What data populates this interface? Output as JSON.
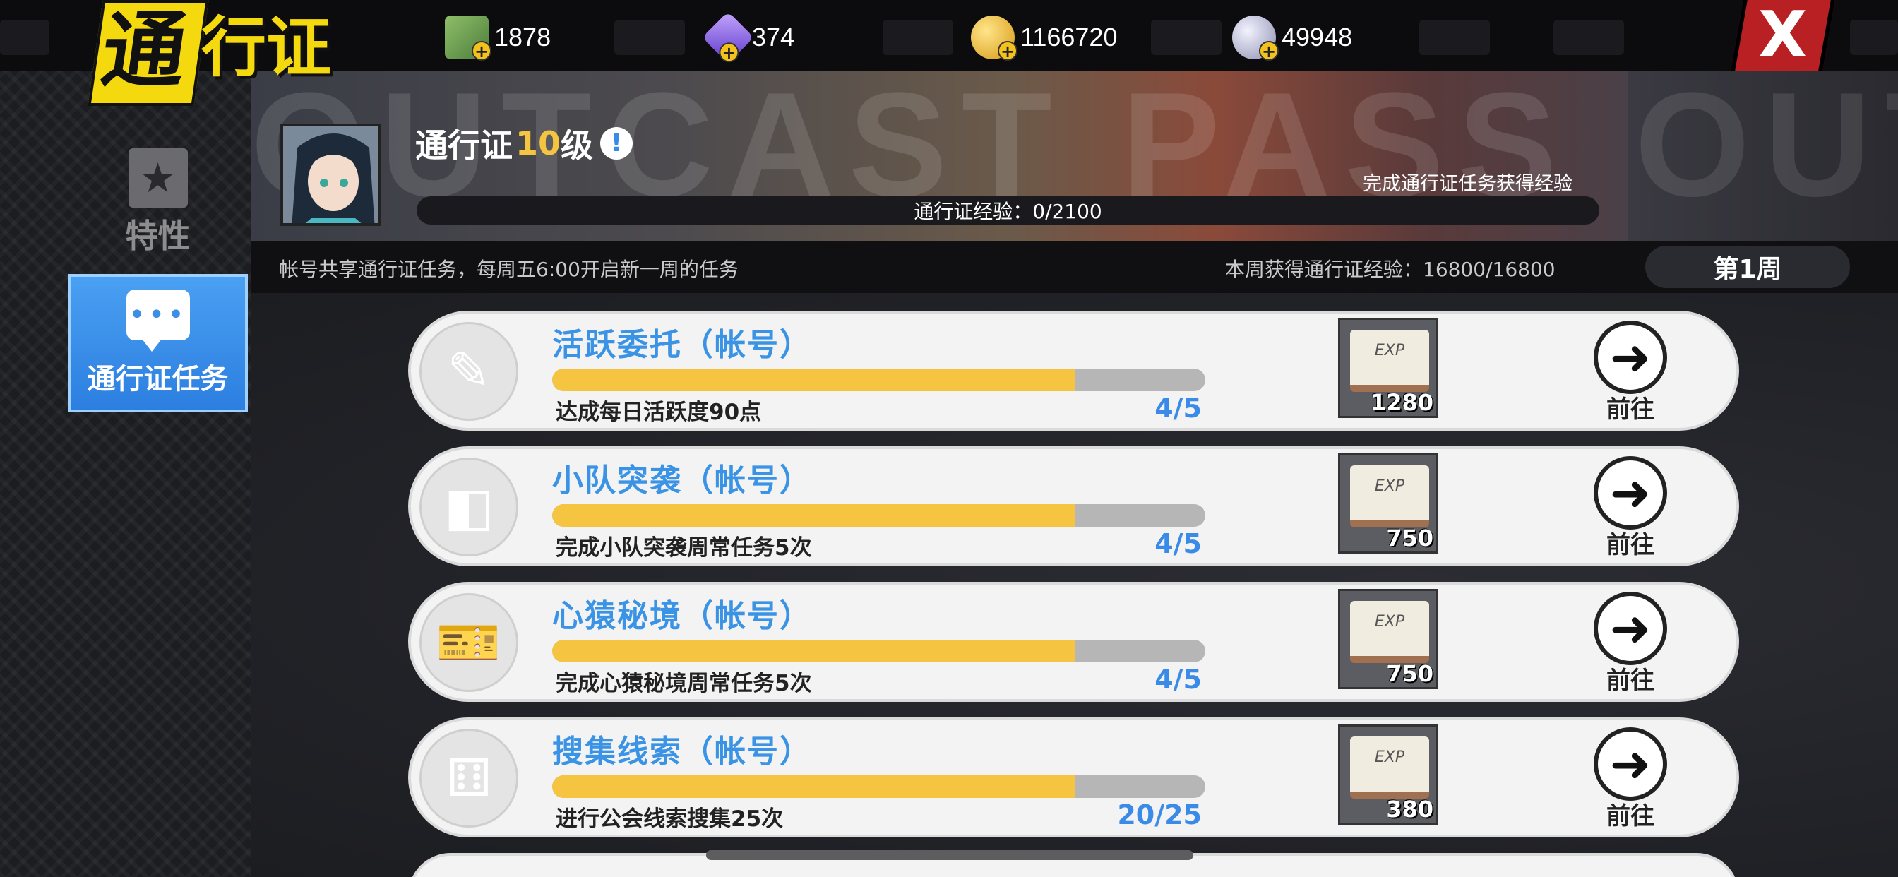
{
  "colors": {
    "accent_blue": "#3a93e4",
    "progress_yellow": "#f5c542",
    "close_red": "#b82024",
    "logo_yellow": "#f5d90f"
  },
  "header": {
    "logo_first_char": "通",
    "logo_rest": "行证",
    "currencies": [
      {
        "icon": "cash-icon",
        "value": "1878"
      },
      {
        "icon": "purple-gem-icon",
        "value": "374"
      },
      {
        "icon": "gold-coin-icon",
        "value": "1166720"
      },
      {
        "icon": "silver-coin-icon",
        "value": "49948"
      }
    ],
    "close_label": "X"
  },
  "sidebar": {
    "items": [
      {
        "label": "特性",
        "icon": "star-icon",
        "active": false
      },
      {
        "label": "通行证任务",
        "icon": "chat-bubble-icon",
        "active": true
      }
    ]
  },
  "banner": {
    "bg_text_left": "OUTCAST PASS",
    "bg_text_right": "OUT",
    "level_prefix": "通行证",
    "level_num": "10",
    "level_suffix": "级",
    "info_icon": "!",
    "exp_hint": "完成通行证任务获得经验",
    "exp_text": "通行证经验：0/2100",
    "exp_current": 0,
    "exp_max": 2100
  },
  "info": {
    "left_text": "帐号共享通行证任务，每周五6:00开启新一周的任务",
    "right_text": "本周获得通行证经验：16800/16800",
    "week_label": "第1周"
  },
  "tasks": [
    {
      "icon": "notebook-pen-icon",
      "icon_glyph": "✎",
      "title": "活跃委托（帐号）",
      "desc": "达成每日活跃度90点",
      "count": "4/5",
      "progress": 0.8,
      "reward": "1280",
      "go_label": "前往"
    },
    {
      "icon": "cube-icon",
      "icon_glyph": "◧",
      "title": "小队突袭（帐号）",
      "desc": "完成小队突袭周常任务5次",
      "count": "4/5",
      "progress": 0.8,
      "reward": "750",
      "go_label": "前往"
    },
    {
      "icon": "ticket-icon",
      "icon_glyph": "🎫",
      "title": "心猿秘境（帐号）",
      "desc": "完成心猿秘境周常任务5次",
      "count": "4/5",
      "progress": 0.8,
      "reward": "750",
      "go_label": "前往"
    },
    {
      "icon": "dice-icon",
      "icon_glyph": "⚅",
      "title": "搜集线索（帐号）",
      "desc": "进行公会线索搜集25次",
      "count": "20/25",
      "progress": 0.8,
      "reward": "380",
      "go_label": "前往"
    }
  ],
  "reward_book_text": "EXP"
}
